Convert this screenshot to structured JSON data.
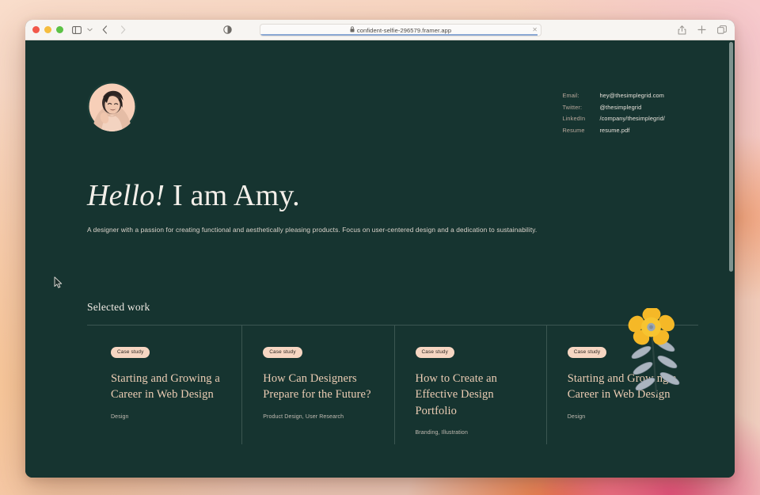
{
  "browser": {
    "window_controls": [
      "close",
      "minimize",
      "maximize"
    ],
    "sidebar_icon": "sidebar-icon",
    "sidebar_chevron": "chevron-down-icon",
    "back_icon": "chevron-left-icon",
    "forward_icon": "chevron-right-icon",
    "shield_icon": "privacy-shield-icon",
    "url": "confident-selfie-296579.framer.app",
    "lock_icon": "lock-icon",
    "stop_icon": "close-icon",
    "share_icon": "share-icon",
    "new_tab_icon": "plus-icon",
    "tab_overview_icon": "tab-overview-icon"
  },
  "site": {
    "avatar_alt": "portrait-photo",
    "contacts": [
      {
        "label": "Email:",
        "value": "hey@thesimplegrid.com"
      },
      {
        "label": "Twitter:",
        "value": "@thesimplegrid"
      },
      {
        "label": "LinkedIn",
        "value": "/company/thesimplegrid/"
      },
      {
        "label": "Resume",
        "value": "resume.pdf"
      }
    ],
    "hero": {
      "greeting": "Hello!",
      "name": " I am Amy.",
      "subtitle": "A designer with a passion for creating functional and aesthetically pleasing products. Focus on user-centered design and a dedication to sustainability."
    },
    "decoration": "flower-illustration",
    "selected_work": {
      "title": "Selected work",
      "cards": [
        {
          "badge": "Case study",
          "title": "Starting and Growing a Career in Web Design",
          "tags": "Design"
        },
        {
          "badge": "Case study",
          "title": "How Can Designers Prepare for the Future?",
          "tags": "Product Design, User Research"
        },
        {
          "badge": "Case study",
          "title": "How to Create an Effective Design Portfolio",
          "tags": "Branding, Illustration"
        },
        {
          "badge": "Case study",
          "title": "Starting and Growing a Career in Web Design",
          "tags": "Design"
        }
      ]
    }
  },
  "colors": {
    "page_bg": "#163430",
    "accent_peach": "#f6d6c2",
    "title_peach": "#eccdb4",
    "flower_petal": "#f5b827",
    "flower_leaf": "#aab4bf"
  }
}
